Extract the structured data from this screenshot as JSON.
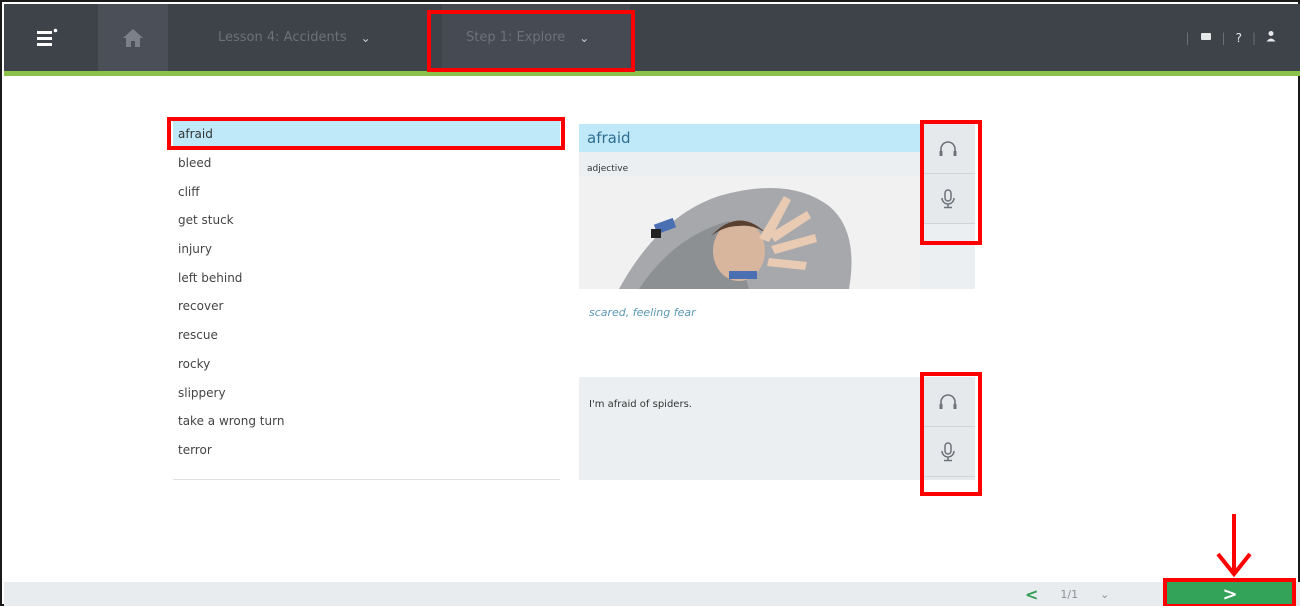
{
  "topbar": {
    "lesson_label": "Lesson 4: Accidents",
    "step_label": "Step 1: Explore",
    "chevron": "⌄",
    "help_label": "?",
    "separator": "|",
    "icons": [
      "menu-icon",
      "home-icon",
      "chat-icon",
      "user-icon"
    ]
  },
  "word_list": {
    "items": [
      {
        "label": "afraid",
        "selected": true
      },
      {
        "label": "bleed"
      },
      {
        "label": "cliff"
      },
      {
        "label": "get stuck"
      },
      {
        "label": "injury"
      },
      {
        "label": "left behind"
      },
      {
        "label": "recover"
      },
      {
        "label": "rescue"
      },
      {
        "label": "rocky"
      },
      {
        "label": "slippery"
      },
      {
        "label": "take a wrong turn"
      },
      {
        "label": "terror"
      }
    ]
  },
  "definition_card": {
    "word": "afraid",
    "part_of_speech": "adjective",
    "definition": "scared, feeling fear",
    "icons": [
      "headphones-icon",
      "microphone-icon"
    ]
  },
  "example_card": {
    "sentence": "I'm afraid of spiders.",
    "icons": [
      "headphones-icon",
      "microphone-icon"
    ]
  },
  "pager": {
    "prev": "<",
    "page": "1/1",
    "next": ">"
  },
  "colors": {
    "topbar": "#3e4249",
    "accent_green": "#8bc34a",
    "selected_row": "#bfe8f8",
    "next_button": "#33a35a",
    "annotation_red": "#ff0000"
  }
}
